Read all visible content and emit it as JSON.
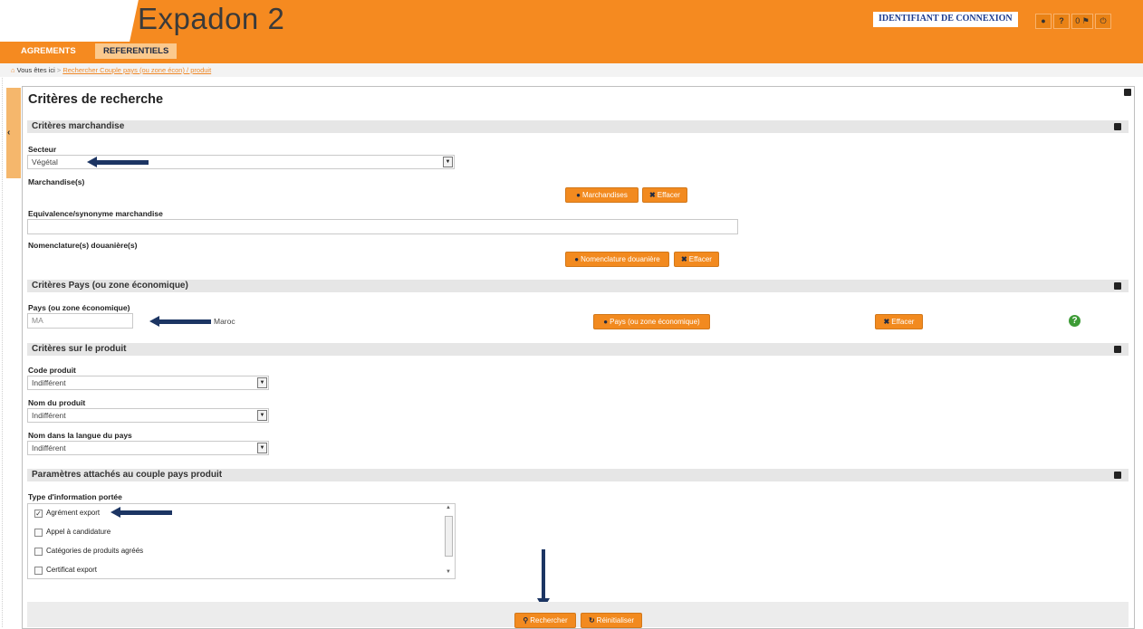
{
  "header": {
    "logo": "Expadon 2",
    "login_label": "IDENTIFIANT DE CONNEXION",
    "buttons": [
      {
        "name": "user-icon",
        "glyph": "👤"
      },
      {
        "name": "help-icon",
        "glyph": "?"
      },
      {
        "name": "flag-icon",
        "glyph": "0 ⚑"
      },
      {
        "name": "power-icon",
        "glyph": "⏻"
      }
    ]
  },
  "tabs": [
    {
      "label": "AGREMENTS"
    },
    {
      "label": "REFERENTIELS"
    }
  ],
  "breadcrumb": {
    "prefix": "Vous êtes ici",
    "separator": ">",
    "link": "Rechercher Couple pays (ou zone écon) / produit"
  },
  "panel": {
    "title": "Critères de recherche"
  },
  "sections": {
    "merch": {
      "title": "Critères marchandise",
      "secteur_label": "Secteur",
      "secteur_value": "Végétal",
      "marchandises_label": "Marchandise(s)",
      "marchandises_btn": "Marchandises",
      "effacer_btn": "Effacer",
      "equivalence_label": "Equivalence/synonyme marchandise",
      "equivalence_value": "",
      "nomenclature_label": "Nomenclature(s) douanière(s)",
      "nomenclature_btn": "Nomenclature douanière",
      "effacer2_btn": "Effacer"
    },
    "pays": {
      "title": "Critères Pays (ou zone économique)",
      "pays_label": "Pays (ou zone économique)",
      "pays_value": "MA",
      "pays_name": "Maroc",
      "pays_btn": "Pays (ou zone économique)",
      "effacer_btn": "Effacer",
      "help": "?"
    },
    "produit": {
      "title": "Critères sur le produit",
      "code_label": "Code produit",
      "code_value": "Indifférent",
      "nom_label": "Nom du produit",
      "nom_value": "Indifférent",
      "langue_label": "Nom dans la langue du pays",
      "langue_value": "Indifférent"
    },
    "params": {
      "title": "Paramètres attachés au couple pays produit",
      "type_label": "Type d'information portée",
      "options": [
        {
          "label": "Agrément export",
          "checked": true
        },
        {
          "label": "Appel à candidature",
          "checked": false
        },
        {
          "label": "Catégories de produits agréés",
          "checked": false
        },
        {
          "label": "Certificat export",
          "checked": false
        }
      ]
    }
  },
  "footer": {
    "search_btn": "Rechercher",
    "reset_btn": "Réinitialiser"
  },
  "colors": {
    "brand_orange": "#f58a20",
    "button_orange": "#f28a1f",
    "arrow_navy": "#1c3563",
    "help_green": "#3d9b36"
  }
}
